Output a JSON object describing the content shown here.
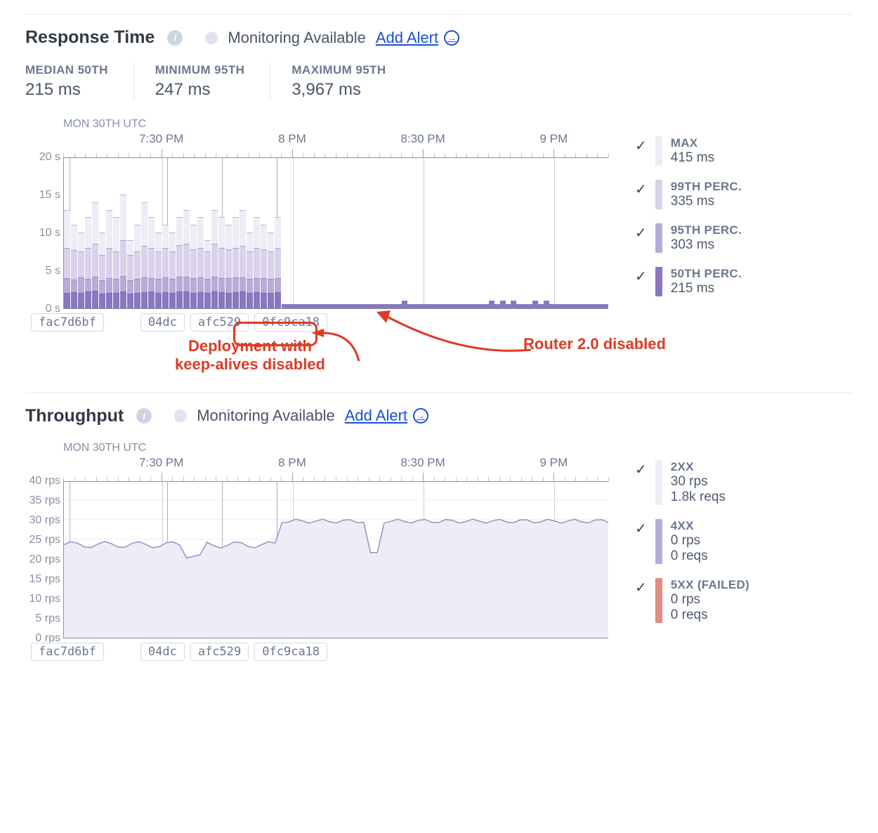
{
  "colors": {
    "max": "#efecf6",
    "p99": "#d9d2ea",
    "p95": "#b8abd7",
    "p50": "#8a77be",
    "twoxx": "#efecf6",
    "fourxx": "#b8abd7",
    "fivexx": "#e48a83"
  },
  "response": {
    "title": "Response Time",
    "monitoring": "Monitoring Available",
    "add_alert": "Add Alert",
    "stats": [
      {
        "label": "MEDIAN 50TH",
        "value": "215 ms"
      },
      {
        "label": "MINIMUM 95TH",
        "value": "247 ms"
      },
      {
        "label": "MAXIMUM 95TH",
        "value": "3,967 ms"
      }
    ],
    "date_label": "MON 30TH UTC",
    "x_ticks": [
      "7:30 PM",
      "8 PM",
      "8:30 PM",
      "9 PM"
    ],
    "y_ticks": [
      "0 s",
      "5 s",
      "10 s",
      "15 s",
      "20 s"
    ],
    "deploy_tags": [
      "fac7d6bf",
      "04dc",
      "afc529",
      "0fc9ca18"
    ],
    "legend": [
      {
        "name": "MAX",
        "value": "415 ms",
        "color": "max"
      },
      {
        "name": "99TH PERC.",
        "value": "335 ms",
        "color": "p99"
      },
      {
        "name": "95TH PERC.",
        "value": "303 ms",
        "color": "p95"
      },
      {
        "name": "50TH PERC.",
        "value": "215 ms",
        "color": "p50"
      }
    ]
  },
  "throughput": {
    "title": "Throughput",
    "monitoring": "Monitoring Available",
    "add_alert": "Add Alert",
    "date_label": "MON 30TH UTC",
    "x_ticks": [
      "7:30 PM",
      "8 PM",
      "8:30 PM",
      "9 PM"
    ],
    "y_ticks": [
      "0 rps",
      "5 rps",
      "10 rps",
      "15 rps",
      "20 rps",
      "25 rps",
      "30 rps",
      "35 rps",
      "40 rps"
    ],
    "deploy_tags": [
      "fac7d6bf",
      "04dc",
      "afc529",
      "0fc9ca18"
    ],
    "legend": [
      {
        "name": "2XX",
        "value1": "30 rps",
        "value2": "1.8k reqs",
        "color": "twoxx"
      },
      {
        "name": "4XX",
        "value1": "0 rps",
        "value2": "0 reqs",
        "color": "fourxx"
      },
      {
        "name": "5XX (FAILED)",
        "value1": "0 rps",
        "value2": "0 reqs",
        "color": "fivexx"
      }
    ]
  },
  "annotations": {
    "deploy": "Deployment with\nkeep-alives disabled",
    "router": "Router 2.0 disabled"
  },
  "chart_data": [
    {
      "name": "Response Time",
      "type": "bar",
      "x_range": [
        "7:10 PM",
        "9:15 PM"
      ],
      "x_ticks": [
        "7:30 PM",
        "8 PM",
        "8:30 PM",
        "9 PM"
      ],
      "y_unit": "seconds",
      "ylim": [
        0,
        20
      ],
      "series": [
        {
          "name": "MAX",
          "values_before_8pm": [
            13,
            11,
            10,
            12,
            14,
            10,
            13,
            12,
            15,
            9,
            11,
            14,
            12,
            10,
            11,
            10,
            12,
            13,
            11,
            12,
            9,
            13,
            12,
            11,
            12,
            13,
            10,
            12,
            11,
            10,
            12
          ],
          "values_after_8pm_approx_ms": 415
        },
        {
          "name": "99TH PERC.",
          "values_before_8pm": [
            8,
            7.7,
            7.5,
            8,
            8.5,
            7,
            8,
            7.5,
            9,
            7,
            7.5,
            8.2,
            8,
            7.5,
            8,
            7.5,
            8.3,
            8.5,
            7.8,
            8,
            7.5,
            8.5,
            8,
            7.8,
            8,
            8.2,
            7.5,
            8,
            7.8,
            7.5,
            8
          ],
          "values_after_8pm_approx_ms": 335
        },
        {
          "name": "95TH PERC.",
          "values_before_8pm": [
            4,
            3.8,
            4.1,
            3.9,
            4.2,
            3.7,
            4,
            3.9,
            4.3,
            3.7,
            3.9,
            4.1,
            4,
            3.9,
            4.1,
            3.9,
            4.2,
            4.2,
            4,
            4.1,
            3.9,
            4.2,
            4,
            4,
            4.1,
            4.1,
            3.9,
            4,
            4,
            3.9,
            4
          ],
          "values_after_8pm_approx_ms": 303
        },
        {
          "name": "50TH PERC.",
          "values_before_8pm": [
            2,
            2.1,
            2,
            2.2,
            2.3,
            1.9,
            2,
            2,
            2.2,
            1.9,
            2,
            2.1,
            2.2,
            2,
            2.1,
            2,
            2.2,
            2.2,
            2,
            2.1,
            2,
            2.2,
            2.1,
            2,
            2.1,
            2.2,
            2,
            2.1,
            2,
            2,
            2.1
          ],
          "values_after_8pm_approx_ms": 215
        }
      ],
      "deploy_markers": [
        "fac7d6bf",
        "04dc",
        "afc529",
        "0fc9ca18"
      ],
      "annotations": [
        "Deployment with keep-alives disabled (points to 0fc9ca18)",
        "Router 2.0 disabled (points to near-zero region after 8 PM)"
      ]
    },
    {
      "name": "Throughput",
      "type": "line",
      "x_range": [
        "7:10 PM",
        "9:15 PM"
      ],
      "x_ticks": [
        "7:30 PM",
        "8 PM",
        "8:30 PM",
        "9 PM"
      ],
      "y_unit": "rps",
      "ylim": [
        0,
        40
      ],
      "series": [
        {
          "name": "2XX",
          "values_before_8pm_approx": 24,
          "notch_near_7_40pm": 21,
          "values_after_8pm_approx": 30,
          "dip_near_8_22pm": 22,
          "total": "1.8k reqs"
        },
        {
          "name": "4XX",
          "values_approx": 0,
          "total": "0 reqs"
        },
        {
          "name": "5XX (FAILED)",
          "values_approx": 0,
          "total": "0 reqs"
        }
      ],
      "deploy_markers": [
        "fac7d6bf",
        "04dc",
        "afc529",
        "0fc9ca18"
      ]
    }
  ]
}
